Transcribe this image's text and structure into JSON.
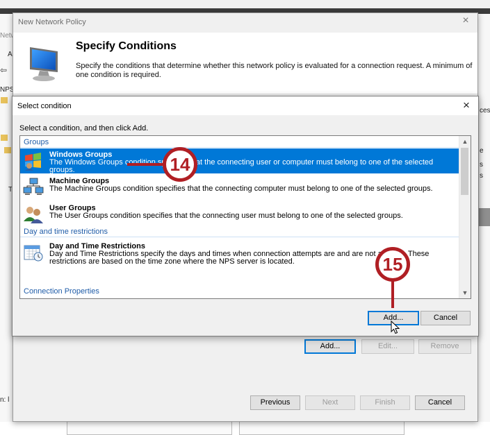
{
  "background": {
    "fragments": [
      "Netw",
      "A",
      "NPS",
      "ces",
      "e",
      "s",
      "s",
      "n: l",
      "T"
    ]
  },
  "new_policy_dialog": {
    "title": "New Network Policy",
    "close_label": "×",
    "header_title": "Specify Conditions",
    "header_desc": "Specify the conditions that determine whether this network policy is evaluated for a connection request. A minimum of one condition is required.",
    "condition_buttons": {
      "add": "Add...",
      "edit": "Edit...",
      "remove": "Remove"
    },
    "nav_buttons": {
      "previous": "Previous",
      "next": "Next",
      "finish": "Finish",
      "cancel": "Cancel"
    }
  },
  "select_condition_dialog": {
    "title": "Select condition",
    "close_label": "×",
    "instruction": "Select a condition, and then click Add.",
    "categories": {
      "groups": "Groups",
      "day_time": "Day and time restrictions",
      "connection": "Connection Properties"
    },
    "items": {
      "windows_groups": {
        "title": "Windows Groups",
        "desc": "The Windows Groups condition specifies that the connecting user or computer must belong to one of the selected groups."
      },
      "machine_groups": {
        "title": "Machine Groups",
        "desc": "The Machine Groups condition specifies that the connecting computer must belong to one of the selected groups."
      },
      "user_groups": {
        "title": "User Groups",
        "desc": "The User Groups condition specifies that the connecting user must belong to one of the selected groups."
      },
      "day_time_restrictions": {
        "title": "Day and Time Restrictions",
        "desc": "Day and Time Restrictions specify the days and times when connection attempts are and are not allowed. These restrictions are based on the time zone where the NPS server is located."
      }
    },
    "buttons": {
      "add": "Add...",
      "cancel": "Cancel"
    }
  },
  "callouts": {
    "step14": "14",
    "step15": "15"
  },
  "colors": {
    "selection": "#0078d7",
    "callout": "#b01f24",
    "category_text": "#1f5ca8"
  }
}
